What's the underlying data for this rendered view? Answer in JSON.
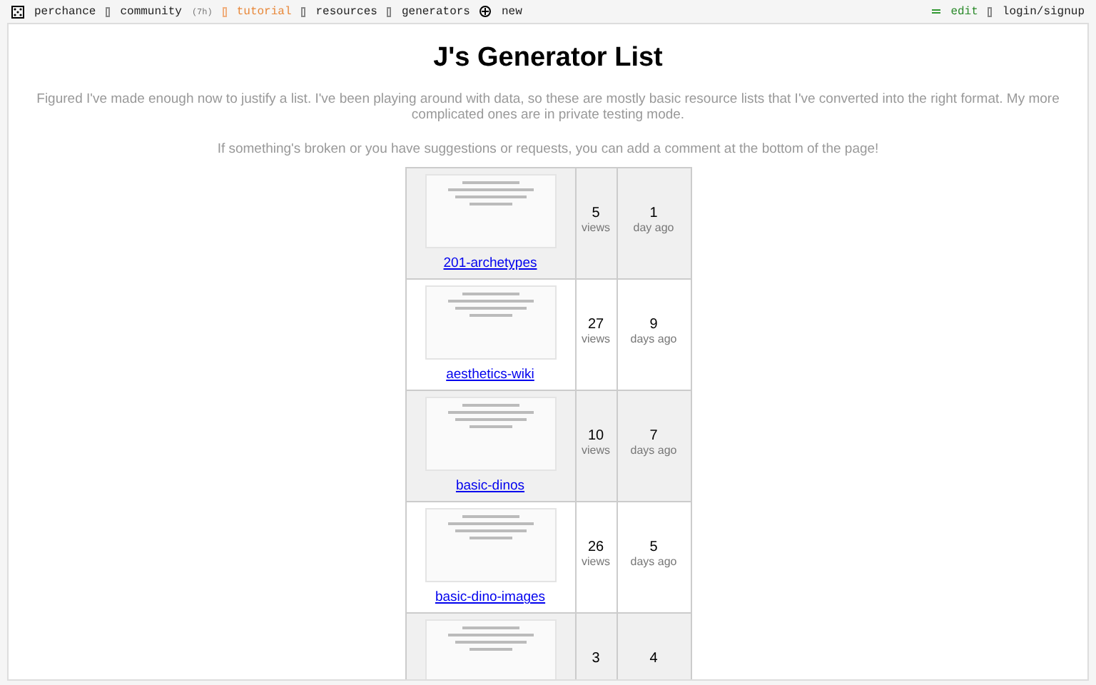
{
  "nav": {
    "left": [
      {
        "kind": "logo",
        "label": "perchance"
      },
      {
        "kind": "plain",
        "label": "community",
        "note": "(7h)"
      },
      {
        "kind": "accent",
        "label": "tutorial"
      },
      {
        "kind": "plain",
        "label": "resources"
      },
      {
        "kind": "plain",
        "label": "generators"
      },
      {
        "kind": "new",
        "label": "new"
      }
    ],
    "right": [
      {
        "kind": "edit",
        "label": "edit"
      },
      {
        "kind": "plain",
        "label": "login/signup"
      }
    ]
  },
  "title": "J's Generator List",
  "intro": [
    "Figured I've made enough now to justify a list. I've been playing around with data, so these are mostly basic resource lists that I've converted into the right format. My more complicated ones are in private testing mode.",
    "If something's broken or you have suggestions or requests, you can add a comment at the bottom of the page!"
  ],
  "generators": [
    {
      "name": "201-archetypes",
      "views": "5",
      "views_unit": "views",
      "age": "1",
      "age_unit": "day ago"
    },
    {
      "name": "aesthetics-wiki",
      "views": "27",
      "views_unit": "views",
      "age": "9",
      "age_unit": "days ago"
    },
    {
      "name": "basic-dinos",
      "views": "10",
      "views_unit": "views",
      "age": "7",
      "age_unit": "days ago"
    },
    {
      "name": "basic-dino-images",
      "views": "26",
      "views_unit": "views",
      "age": "5",
      "age_unit": "days ago"
    },
    {
      "views": "3",
      "age": "4"
    }
  ]
}
